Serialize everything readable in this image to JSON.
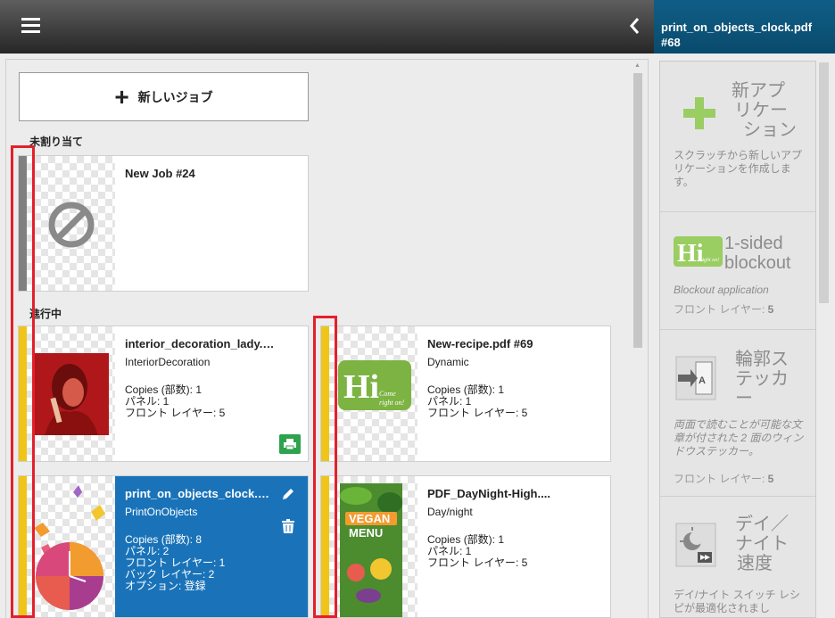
{
  "header": {
    "menu_icon": "hamburger-icon",
    "collapse_icon": "chevron-left-icon",
    "title_line1": "print_on_objects_clock.pdf",
    "title_line2": "#68"
  },
  "new_job_button": "新しいジョブ",
  "sections": {
    "unassigned": "未割り当て",
    "in_progress": "進行中"
  },
  "jobs": [
    {
      "name": "New Job #24",
      "app": "",
      "lines": [],
      "thumb_icon": "no-image-icon",
      "bar_color": "#808080"
    },
    {
      "name": "interior_decoration_lady.p...",
      "app": "InteriorDecoration",
      "lines": [
        "Copies (部数): 1",
        "パネル: 1",
        "フロント レイヤー: 5"
      ],
      "thumb_icon": "lady-photo-icon",
      "bar_color": "#f0c419"
    },
    {
      "name": "New-recipe.pdf #69",
      "app": "Dynamic",
      "lines": [
        "Copies (部数): 1",
        "パネル: 1",
        "フロント レイヤー: 5"
      ],
      "thumb_icon": "hi-logo-icon",
      "bar_color": "#f0c419"
    },
    {
      "name": "print_on_objects_clock.pd...",
      "app": "PrintOnObjects",
      "lines": [
        "Copies (部数): 8",
        "パネル: 2",
        "フロント レイヤー: 1",
        "バック レイヤー: 2",
        "オプション: 登録"
      ],
      "thumb_icon": "butterfly-clock-icon",
      "bar_color": "#f0c419"
    },
    {
      "name": "PDF_DayNight-High....",
      "app": "Day/night",
      "lines": [
        "Copies (部数): 1",
        "パネル: 1",
        "フロント レイヤー: 5"
      ],
      "thumb_icon": "vegan-menu-icon",
      "bar_color": "#f0c419"
    }
  ],
  "hi_logo": {
    "big": "Hi",
    "small": "Come right on!"
  },
  "vegan_menu": {
    "top": "VEGAN",
    "bottom": "MENU"
  },
  "sidebar": [
    {
      "title_lines": [
        "新アプ",
        "リケー",
        "ション"
      ],
      "desc": "スクラッチから新しいアプリケーションを作成します。",
      "front": "",
      "icon": "plus-icon"
    },
    {
      "title_lines": [
        "1-sided",
        "blockout"
      ],
      "desc": "Blockout application",
      "front_label": "フロント レイヤー:",
      "front_value": "5",
      "icon": "hi-logo-icon"
    },
    {
      "title_lines": [
        "輪郭ス",
        "テッカ",
        "ー"
      ],
      "desc": "両面で読むことが可能な文章が付された 2 面のウィンドウステッカー。",
      "front_label": "フロント レイヤー:",
      "front_value": "5",
      "icon": "sticker-icon"
    },
    {
      "title_lines": [
        "デイ／",
        "ナイト",
        "速度"
      ],
      "desc": "デイ/ナイト スイッチ レシピが最適化されまし",
      "front": "",
      "icon": "day-night-icon"
    }
  ],
  "colors": {
    "accent": "#1a73b9",
    "pending": "#f0c419",
    "unassigned": "#808080",
    "print": "#2ea24d",
    "highlight": "#e3202b"
  }
}
